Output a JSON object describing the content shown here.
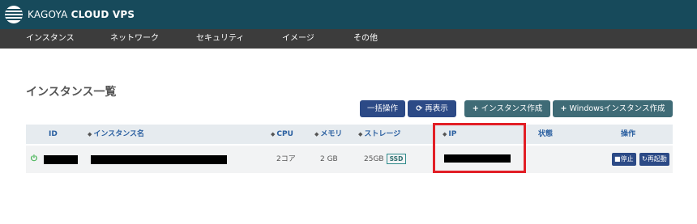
{
  "header": {
    "brand_a": "KAGOYA",
    "brand_b": "CLOUD VPS"
  },
  "nav": {
    "items": [
      {
        "label": "インスタンス"
      },
      {
        "label": "ネットワーク"
      },
      {
        "label": "セキュリティ"
      },
      {
        "label": "イメージ"
      },
      {
        "label": "その他"
      }
    ]
  },
  "main": {
    "title": "インスタンス一覧",
    "toolbar": {
      "bulk_label": "一括操作",
      "refresh_label": "再表示",
      "create_label": "インスタンス作成",
      "create_windows_label": "Windowsインスタンス作成"
    }
  },
  "table": {
    "columns": {
      "id": "ID",
      "name": "インスタンス名",
      "cpu": "CPU",
      "memory": "メモリ",
      "storage": "ストレージ",
      "ip": "IP",
      "status": "状態",
      "ops": "操作"
    },
    "rows": [
      {
        "cpu": "2コア",
        "memory": "2 GB",
        "storage": "25GB",
        "storage_type": "SSD",
        "stop_label": "停止",
        "restart_label": "再起動"
      }
    ]
  },
  "icons": {
    "power": "power-icon",
    "refresh": "refresh-icon",
    "plus": "plus-icon",
    "stop": "stop-icon",
    "restart": "restart-icon",
    "sort": "sort-icon"
  },
  "colors": {
    "header_bg": "#174a5b",
    "nav_bg": "#3c3c3c",
    "primary_button": "#2c4a86",
    "create_button": "#3f6b76",
    "column_header_text": "#2a5fa0",
    "power_on": "#3ab04a",
    "highlight": "#e21f26"
  }
}
